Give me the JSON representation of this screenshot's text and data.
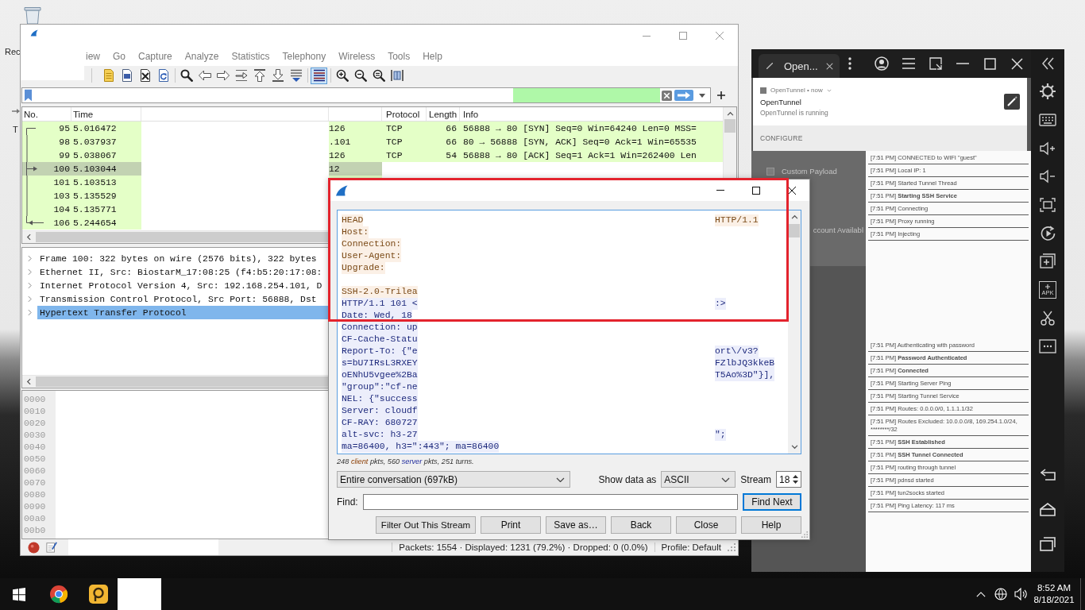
{
  "desktop": {
    "icons": [
      {
        "label": "Rec"
      },
      {
        "label": "T"
      }
    ]
  },
  "wireshark": {
    "menu": [
      "iew",
      "Go",
      "Capture",
      "Analyze",
      "Statistics",
      "Telephony",
      "Wireless",
      "Tools",
      "Help"
    ],
    "toolbar": {
      "coloring_on": true
    },
    "packet_list": {
      "columns": {
        "no": "No.",
        "time": "Time",
        "protocol": "Protocol",
        "length": "Length",
        "info": "Info"
      },
      "rows": [
        {
          "no": "95",
          "time": "5.016472",
          "column_3": "126",
          "protocol": "TCP",
          "length": "66",
          "info": "56888 → 80 [SYN] Seq=0 Win=64240 Len=0 MSS=",
          "kind": "first",
          "selected": false
        },
        {
          "no": "98",
          "time": "5.037937",
          "column_3": ".101",
          "protocol": "TCP",
          "length": "66",
          "info": "80 → 56888 [SYN, ACK] Seq=0 Ack=1 Win=65535",
          "kind": "middle",
          "selected": false
        },
        {
          "no": "99",
          "time": "5.038067",
          "column_3": "126",
          "protocol": "TCP",
          "length": "54",
          "info": "56888 → 80 [ACK] Seq=1 Ack=1 Win=262400 Len",
          "kind": "middle",
          "selected": false
        },
        {
          "no": "100",
          "time": "5.103044",
          "column_3": "12",
          "kind": "request",
          "selected": true
        },
        {
          "no": "101",
          "time": "5.103513",
          "kind": "middle",
          "selected": false
        },
        {
          "no": "103",
          "time": "5.135529",
          "kind": "middle",
          "selected": false
        },
        {
          "no": "104",
          "time": "5.135771",
          "kind": "middle",
          "selected": false
        },
        {
          "no": "106",
          "time": "5.244654",
          "kind": "response",
          "selected": false
        }
      ]
    },
    "details": [
      {
        "label": "Frame 100: 322 bytes on wire (2576 bits), 322 bytes",
        "expanded": false,
        "selected": false
      },
      {
        "label": "Ethernet II, Src: BiostarM_17:08:25 (f4:b5:20:17:08:",
        "expanded": false,
        "selected": false
      },
      {
        "label": "Internet Protocol Version 4, Src: 192.168.254.101, D",
        "expanded": false,
        "selected": false
      },
      {
        "label": "Transmission Control Protocol, Src Port: 56888, Dst",
        "expanded": false,
        "selected": false
      },
      {
        "label": "Hypertext Transfer Protocol",
        "expanded": false,
        "selected": true
      }
    ],
    "bytes_offsets": [
      "0000",
      "0010",
      "0020",
      "0030",
      "0040",
      "0050",
      "0060",
      "0070",
      "0080",
      "0090",
      "00a0",
      "00b0"
    ],
    "status_bar": {
      "packets": "Packets: 1554 · Displayed: 1231 (79.2%) · Dropped: 0 (0.0%)",
      "profile": "Profile: Default"
    }
  },
  "follow_stream": {
    "lines": [
      {
        "kind": "client",
        "text": "HEAD",
        "tail": "HTTP/1.1"
      },
      {
        "kind": "client",
        "text": "Host:"
      },
      {
        "kind": "client",
        "text": "Connection:"
      },
      {
        "kind": "client",
        "text": "User-Agent:"
      },
      {
        "kind": "client",
        "text": "Upgrade:"
      },
      {
        "kind": "blank"
      },
      {
        "kind": "client",
        "text": "SSH-2.0-Trilea"
      },
      {
        "kind": "server",
        "text": "HTTP/1.1 101 <",
        "tail": ":>"
      },
      {
        "kind": "server",
        "text": "Date: Wed, 18"
      },
      {
        "kind": "server",
        "text": "Connection: up"
      },
      {
        "kind": "server",
        "text": "CF-Cache-Statu"
      },
      {
        "kind": "server",
        "text": "Report-To: {\"e",
        "tail": "ort\\/v3?"
      },
      {
        "kind": "server",
        "text": "s=bU7IRsL3RXEY",
        "tail": "FZlbJQ3kkeB"
      },
      {
        "kind": "server",
        "text": "oENhU5vgee%2Ba",
        "tail": "T5Ao%3D\"}],"
      },
      {
        "kind": "server",
        "text": "\"group\":\"cf-ne"
      },
      {
        "kind": "server",
        "text": "NEL: {\"success"
      },
      {
        "kind": "server",
        "text": "Server: cloudf"
      },
      {
        "kind": "server",
        "text": "CF-RAY: 680727"
      },
      {
        "kind": "server",
        "text": "alt-svc: h3-27",
        "tail": "\";"
      },
      {
        "kind": "server",
        "text": "ma=86400, h3=\":443\"; ma=86400"
      }
    ],
    "summary": [
      {
        "text": "248 ",
        "kind": "plain"
      },
      {
        "text": "client",
        "kind": "client"
      },
      {
        "text": " pkts, 560 ",
        "kind": "plain"
      },
      {
        "text": "server",
        "kind": "server"
      },
      {
        "text": " pkts, 251 turns.",
        "kind": "plain"
      }
    ],
    "controls": {
      "conversation": "Entire conversation (697kB)",
      "show_as_label": "Show data as",
      "show_as": "ASCII",
      "stream_label": "Stream",
      "stream": "18",
      "find_label": "Find:",
      "find_next": {
        "label": "Find Next",
        "focused": true
      },
      "buttons": [
        "Filter Out This Stream",
        "Print",
        "Save as…",
        "Back",
        "Close",
        "Help"
      ]
    }
  },
  "emulator": {
    "tab": {
      "label": "Open..."
    },
    "notification": {
      "header": "OpenTunnel • now",
      "title": "OpenTunnel",
      "text": "OpenTunnel is running",
      "action": "CONFIGURE"
    },
    "background_texts": [
      "Custom Payload",
      "ccount Availabl"
    ],
    "log": [
      {
        "kind": "entry",
        "time": "[7:51 PM]",
        "message": "CONNECTED to WIFI \"guest\"",
        "bold": false
      },
      {
        "kind": "entry",
        "time": "[7:51 PM]",
        "message": "Local IP: 1",
        "bold": false
      },
      {
        "kind": "entry",
        "time": "[7:51 PM]",
        "message": "Started Tunnel Thread",
        "bold": false
      },
      {
        "kind": "entry",
        "time": "[7:51 PM]",
        "message": "Starting SSH Service",
        "bold": true
      },
      {
        "kind": "entry",
        "time": "[7:51 PM]",
        "message": "Connecting",
        "bold": false
      },
      {
        "kind": "entry",
        "time": "[7:51 PM]",
        "message": "Proxy running",
        "bold": false
      },
      {
        "kind": "entry",
        "time": "[7:51 PM]",
        "message": "Injecting",
        "bold": false
      },
      {
        "kind": "redacted"
      },
      {
        "kind": "entry",
        "time": "[7:51 PM]",
        "message": "Authenticating with password",
        "bold": false
      },
      {
        "kind": "entry",
        "time": "[7:51 PM]",
        "message": "Password Authenticated",
        "bold": true
      },
      {
        "kind": "entry",
        "time": "[7:51 PM]",
        "message": "Connected",
        "bold": true
      },
      {
        "kind": "entry",
        "time": "[7:51 PM]",
        "message": "Starting Server Ping",
        "bold": false
      },
      {
        "kind": "entry",
        "time": "[7:51 PM]",
        "message": "Starting Tunnel Service",
        "bold": false
      },
      {
        "kind": "entry",
        "time": "[7:51 PM]",
        "message": "Routes: 0.0.0.0/0, 1.1.1.1/32",
        "bold": false
      },
      {
        "kind": "entry",
        "time": "[7:51 PM]",
        "message": "Routes Excluded: 10.0.0.0/8, 169.254.1.0/24, ********/32",
        "bold": false
      },
      {
        "kind": "entry",
        "time": "[7:51 PM]",
        "message": "SSH Established",
        "bold": true
      },
      {
        "kind": "entry",
        "time": "[7:51 PM]",
        "message": "SSH Tunnel Connected",
        "bold": true
      },
      {
        "kind": "entry",
        "time": "[7:51 PM]",
        "message": "routing through tunnel",
        "bold": false
      },
      {
        "kind": "entry",
        "time": "[7:51 PM]",
        "message": "pdnsd started",
        "bold": false
      },
      {
        "kind": "entry",
        "time": "[7:51 PM]",
        "message": "tun2socks started",
        "bold": false
      },
      {
        "kind": "entry",
        "time": "[7:51 PM]",
        "message": "Ping Latency: 117 ms",
        "bold": false
      }
    ],
    "sidebar": {
      "apk_label": "APK"
    }
  },
  "taskbar": {
    "clock": {
      "time": "8:52 AM",
      "date": "8/18/2021"
    }
  }
}
